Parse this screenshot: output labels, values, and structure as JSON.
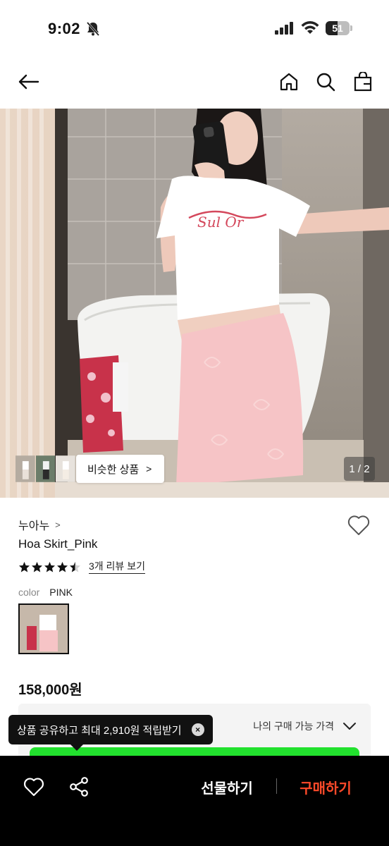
{
  "status_bar": {
    "time": "9:02",
    "battery": "51",
    "battery_level": 0.51
  },
  "nav": {
    "icons": [
      "back-arrow-icon",
      "home-icon",
      "search-icon",
      "shopping-bag-icon"
    ]
  },
  "gallery": {
    "similar_label": "비슷한 상품",
    "similar_chevron": ">",
    "page_counter": "1 / 2"
  },
  "product": {
    "brand": "누아누",
    "brand_chevron": ">",
    "name": "Hoa Skirt_Pink",
    "rating": 4.5,
    "review_link": "3개 리뷰 보기",
    "color_label": "color",
    "color_value": "PINK",
    "price": "158,000원"
  },
  "price_panel": {
    "my_price_label": "나의 구매 가능 가격"
  },
  "tooltip": {
    "text": "상품 공유하고 최대 2,910원 적립받기",
    "close_glyph": "×"
  },
  "bottom_bar": {
    "gift_label": "선물하기",
    "buy_label": "구매하기",
    "buy_color": "#ff4a2a"
  },
  "colors": {
    "accent_green": "#22e12e",
    "skirt_pink": "#f6c4c6"
  }
}
